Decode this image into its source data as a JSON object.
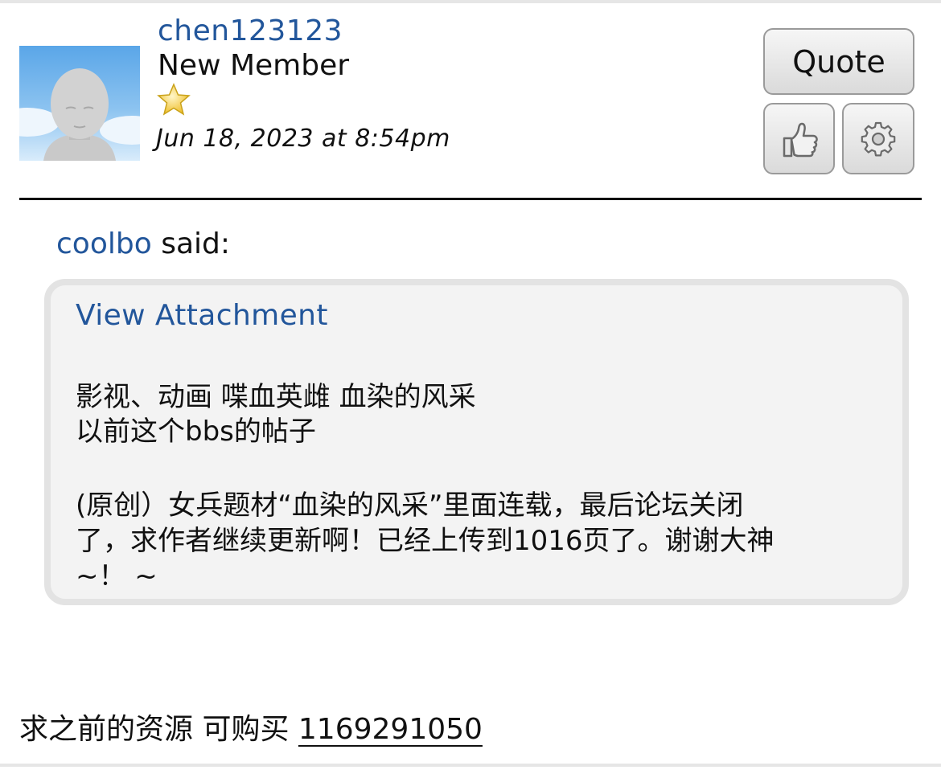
{
  "post": {
    "username": "chen123123",
    "rank": "New Member",
    "date": "Jun 18, 2023 at 8:54pm",
    "avatar_icon": "default-avatar-icon",
    "rank_icon": "star-icon"
  },
  "actions": {
    "quote_label": "Quote",
    "like_icon": "thumbs-up-icon",
    "options_icon": "gear-icon"
  },
  "quote": {
    "author": "coolbo",
    "said": "said:",
    "attachment_link": "View Attachment",
    "lines": [
      "影视、动画 喋血英雌 血染的风采",
      "以前这个bbs的帖子",
      "(原创）女兵题材“血染的风采”里面连载，最后论坛关闭",
      "了，求作者继续更新啊！已经上传到1016页了。谢谢大神",
      "~！ ~"
    ]
  },
  "reply": {
    "text": "求之前的资源 可购买",
    "link": "1169291050"
  },
  "colors": {
    "link": "#22569b",
    "quote_bg": "#f3f3f3",
    "quote_border": "#e3e3e3"
  }
}
